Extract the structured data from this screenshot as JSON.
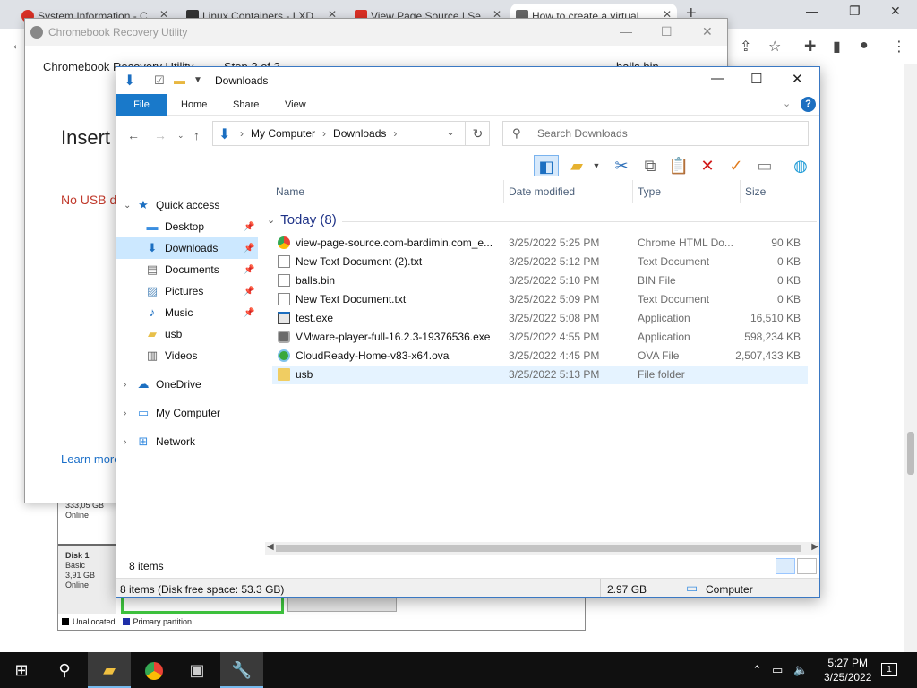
{
  "browser": {
    "tabs": [
      {
        "label": "System Information - C"
      },
      {
        "label": "Linux Containers - LXD"
      },
      {
        "label": "View Page Source | Se"
      },
      {
        "label": "How to create a virtual"
      }
    ],
    "new_tab": "+"
  },
  "disk_management": {
    "disk0_size": "333,05 GB",
    "disk0_status": "Online",
    "disk1_name": "Disk 1",
    "disk1_type": "Basic",
    "disk1_size": "3,91 GB",
    "disk1_status": "Online",
    "legend": [
      {
        "label": "Unallocated",
        "color": "#000000"
      },
      {
        "label": "Primary partition",
        "color": "#1f2fa8"
      }
    ]
  },
  "recovery": {
    "window_title": "Chromebook Recovery Utility",
    "header": "Chromebook Recovery Utility",
    "step": "Step 2 of 3",
    "file": "balls.bin",
    "heading": "Insert",
    "warning": "No USB dr",
    "learn_more": "Learn more"
  },
  "explorer": {
    "title": "Downloads",
    "ribbon_tabs": [
      "File",
      "Home",
      "Share",
      "View"
    ],
    "path": [
      "My Computer",
      "Downloads"
    ],
    "search_placeholder": "Search Downloads",
    "nav": {
      "quick_access": "Quick access",
      "desktop": "Desktop",
      "downloads": "Downloads",
      "documents": "Documents",
      "pictures": "Pictures",
      "music": "Music",
      "usb": "usb",
      "videos": "Videos",
      "onedrive": "OneDrive",
      "my_computer": "My Computer",
      "network": "Network"
    },
    "columns": {
      "name": "Name",
      "date": "Date modified",
      "type": "Type",
      "size": "Size"
    },
    "group_label": "Today (8)",
    "files": [
      {
        "name": "view-page-source.com-bardimin.com_e...",
        "date": "3/25/2022 5:25 PM",
        "type": "Chrome HTML Do...",
        "size": "90 KB",
        "icon": "chrome-icon"
      },
      {
        "name": "New Text Document (2).txt",
        "date": "3/25/2022 5:12 PM",
        "type": "Text Document",
        "size": "0 KB",
        "icon": "text-file-icon"
      },
      {
        "name": "balls.bin",
        "date": "3/25/2022 5:10 PM",
        "type": "BIN File",
        "size": "0 KB",
        "icon": "file-icon"
      },
      {
        "name": "New Text Document.txt",
        "date": "3/25/2022 5:09 PM",
        "type": "Text Document",
        "size": "0 KB",
        "icon": "text-file-icon"
      },
      {
        "name": "test.exe",
        "date": "3/25/2022 5:08 PM",
        "type": "Application",
        "size": "16,510 KB",
        "icon": "app-icon"
      },
      {
        "name": "VMware-player-full-16.2.3-19376536.exe",
        "date": "3/25/2022 4:55 PM",
        "type": "Application",
        "size": "598,234 KB",
        "icon": "vmware-icon"
      },
      {
        "name": "CloudReady-Home-v83-x64.ova",
        "date": "3/25/2022 4:45 PM",
        "type": "OVA File",
        "size": "2,507,433 KB",
        "icon": "ova-icon"
      },
      {
        "name": "usb",
        "date": "3/25/2022 5:13 PM",
        "type": "File folder",
        "size": "",
        "icon": "folder-icon"
      }
    ],
    "item_count": "8 items",
    "status_summary": "8 items (Disk free space: 53.3 GB)",
    "status_size": "2.97 GB",
    "status_location": "Computer"
  },
  "taskbar": {
    "time": "5:27 PM",
    "date": "3/25/2022",
    "notification_count": "1"
  }
}
